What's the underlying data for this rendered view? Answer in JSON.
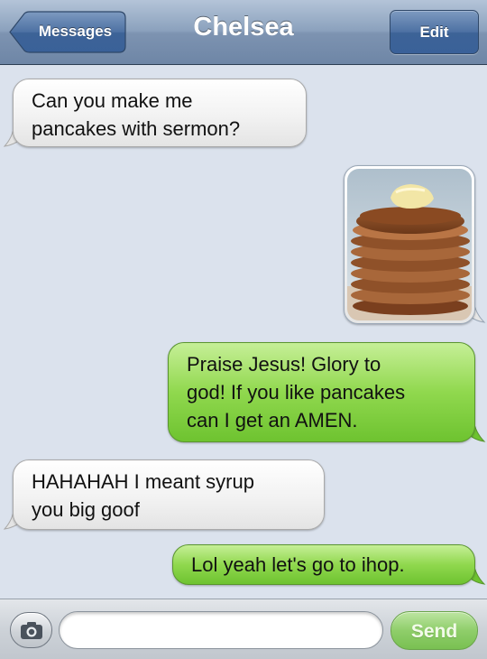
{
  "navbar": {
    "title": "Chelsea",
    "back_label": "Messages",
    "edit_label": "Edit"
  },
  "messages": [
    {
      "direction": "incoming",
      "type": "text",
      "lines": [
        "Can you make me",
        "pancakes with sermon?"
      ]
    },
    {
      "direction": "outgoing",
      "type": "image",
      "image": "pancake-stack-photo"
    },
    {
      "direction": "outgoing",
      "type": "text",
      "lines": [
        "Praise Jesus! Glory to",
        "god! If you like pancakes",
        "can I get an AMEN."
      ]
    },
    {
      "direction": "incoming",
      "type": "text",
      "lines": [
        "HAHAHAH I meant syrup",
        "you big goof"
      ]
    },
    {
      "direction": "outgoing",
      "type": "text",
      "lines": [
        "Lol yeah let's go to ihop."
      ]
    }
  ],
  "input_bar": {
    "camera_icon": "camera-icon",
    "text_value": "",
    "send_label": "Send"
  },
  "colors": {
    "outgoing_bubble": "#90d84e",
    "incoming_bubble": "#f2f2f2",
    "background": "#dbe2ed",
    "navbar": "#7d93b1"
  }
}
